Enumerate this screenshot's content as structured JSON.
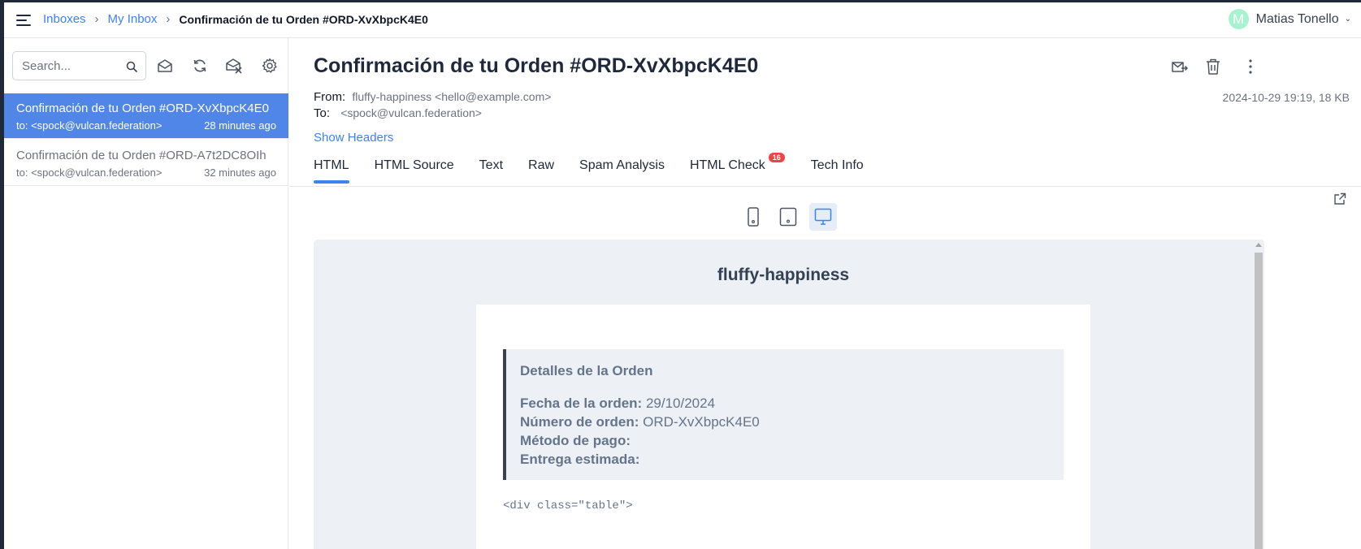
{
  "breadcrumb": {
    "items": [
      "Inboxes",
      "My Inbox"
    ],
    "separator": "›",
    "current": "Confirmación de tu Orden #ORD-XvXbpcK4E0"
  },
  "user": {
    "initial": "M",
    "name": "Matias Tonello",
    "caret": "⌄"
  },
  "sidebar": {
    "search_placeholder": "Search...",
    "toolbar_icons": [
      "mark-read-icon",
      "refresh-icon",
      "delete-all-icon",
      "settings-icon"
    ],
    "messages": [
      {
        "subject": "Confirmación de tu Orden #ORD-XvXbpcK4E0",
        "to": "to: <spock@vulcan.federation>",
        "time": "28 minutes ago",
        "selected": true
      },
      {
        "subject": "Confirmación de tu Orden #ORD-A7t2DC8OIh",
        "to": "to: <spock@vulcan.federation>",
        "time": "32 minutes ago",
        "selected": false
      }
    ]
  },
  "message": {
    "subject": "Confirmación de tu Orden #ORD-XvXbpcK4E0",
    "from_label": "From:",
    "from_value": "fluffy-happiness <hello@example.com>",
    "to_label": "To:",
    "to_value": "<spock@vulcan.federation>",
    "date_size": "2024-10-29 19:19, 18 KB",
    "show_headers": "Show Headers",
    "actions": [
      "release-icon",
      "trash-icon",
      "more-icon"
    ]
  },
  "tabs": [
    {
      "label": "HTML",
      "active": true
    },
    {
      "label": "HTML Source"
    },
    {
      "label": "Text"
    },
    {
      "label": "Raw"
    },
    {
      "label": "Spam Analysis"
    },
    {
      "label": "HTML Check",
      "badge": "16"
    },
    {
      "label": "Tech Info"
    }
  ],
  "preview": {
    "devices": [
      "phone-icon",
      "tablet-icon",
      "desktop-icon"
    ],
    "selected_device": "desktop-icon",
    "brand": "fluffy-happiness",
    "details_title": "Detalles de la Orden",
    "rows": [
      {
        "label": "Fecha de la orden:",
        "value": "29/10/2024"
      },
      {
        "label": "Número de orden:",
        "value": "ORD-XvXbpcK4E0"
      },
      {
        "label": "Método de pago:",
        "value": ""
      },
      {
        "label": "Entrega estimada:",
        "value": ""
      }
    ],
    "code_line": "<div class=\"table\">"
  },
  "colors": {
    "accent": "#3b82f6",
    "selected_row": "#4f86e8",
    "badge": "#ef4444",
    "avatar": "#a7f3d0"
  }
}
